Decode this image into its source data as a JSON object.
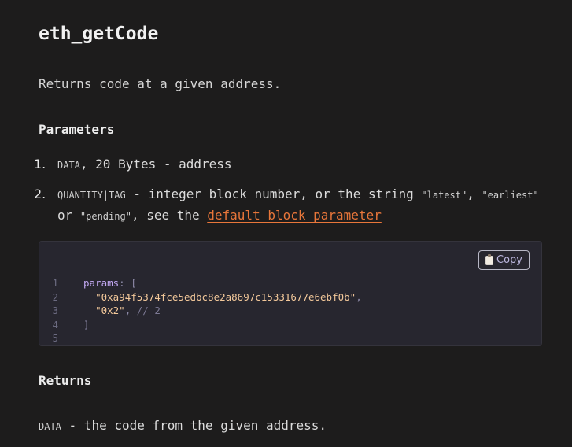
{
  "title": "eth_getCode",
  "intro": "Returns code at a given address.",
  "parameters": {
    "heading": "Parameters",
    "items": [
      {
        "number": "1.",
        "type": "DATA",
        "desc": ", 20 Bytes - address"
      },
      {
        "number": "2.",
        "type": "QUANTITY|TAG",
        "desc_a": " - integer block number, or the string ",
        "v_latest": "\"latest\"",
        "comma": ", ",
        "v_earliest": "\"earliest\"",
        "or": " or ",
        "v_pending": "\"pending\"",
        "desc_b": ", see the ",
        "link": "default block parameter"
      }
    ]
  },
  "code": {
    "copy_label": "Copy",
    "copy_icon": "clipboard-icon",
    "lines": [
      {
        "n": "1",
        "key": "params",
        "colon": ": ",
        "bracket": "["
      },
      {
        "n": "2",
        "val": "\"0xa94f5374fce5edbc8e2a8697c15331677e6ebf0b\"",
        "comma": ","
      },
      {
        "n": "3",
        "val": "\"0x2\"",
        "comma": ",",
        "comment": " // 2"
      },
      {
        "n": "4",
        "bracket": "]"
      },
      {
        "n": "5"
      }
    ]
  },
  "returns": {
    "heading": "Returns",
    "type": "DATA",
    "desc": " - the code from the given address."
  },
  "colors": {
    "background": "#1d1c1c",
    "code_bg": "#27262f",
    "link": "#e8763a",
    "keyword": "#c2a8f2",
    "string": "#f3c89a"
  }
}
